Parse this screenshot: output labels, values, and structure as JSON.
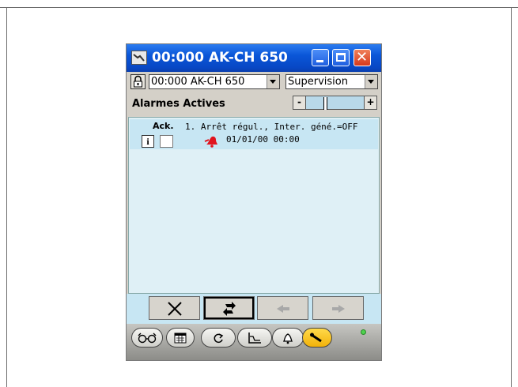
{
  "window": {
    "title": "00:000 AK-CH 650"
  },
  "toolbar": {
    "device_select_value": "00:000 AK-CH 650",
    "view_select_value": "Supervision"
  },
  "section": {
    "title": "Alarmes Actives",
    "scroll_left_label": "-",
    "scroll_right_label": "+"
  },
  "alarms": [
    {
      "ack_label": "Ack.",
      "text": "1. Arrêt régul., Inter. géné.=OFF",
      "info_label": "i",
      "time": "01/01/00 00:00"
    }
  ],
  "nav": {
    "delete_icon": "x-icon",
    "refresh_icon": "refresh-icon",
    "prev_icon": "arrow-left-icon",
    "next_icon": "arrow-right-icon"
  },
  "dock": {
    "icons": [
      "glasses-icon",
      "calendar-icon",
      "history-icon",
      "graph-icon",
      "bell-icon",
      "wrench-icon"
    ],
    "status_led_color": "#4fd24f"
  },
  "colors": {
    "titlebar": "#0a56d8",
    "list_background": "#dff0f6",
    "alarm_bell": "#e0141e",
    "active_dock_button": "#f2b20a"
  }
}
